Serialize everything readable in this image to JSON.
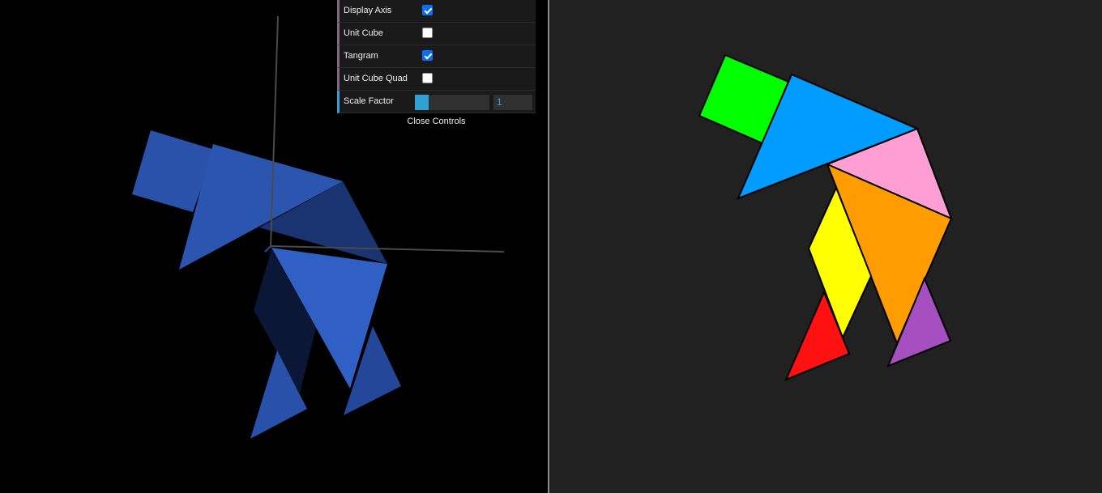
{
  "controls": {
    "items": [
      {
        "label": "Display Axis",
        "type": "checkbox",
        "checked": true
      },
      {
        "label": "Unit Cube",
        "type": "checkbox",
        "checked": false
      },
      {
        "label": "Tangram",
        "type": "checkbox",
        "checked": true
      },
      {
        "label": "Unit Cube Quad",
        "type": "checkbox",
        "checked": false
      }
    ],
    "scale": {
      "label": "Scale Factor",
      "value": "1",
      "level": 0.18
    },
    "close_label": "Close Controls"
  },
  "colors": {
    "left_background": "#000000",
    "right_background": "#212121",
    "projected_piece": "#3160c4",
    "square": "#00ff00",
    "large_triangle_1": "#009cff",
    "large_triangle_2": "#ff9c00",
    "parallelogram": "#ffff00",
    "medium_triangle": "#ff9ed3",
    "small_triangle_1": "#ff1111",
    "small_triangle_2": "#a64fc0"
  }
}
